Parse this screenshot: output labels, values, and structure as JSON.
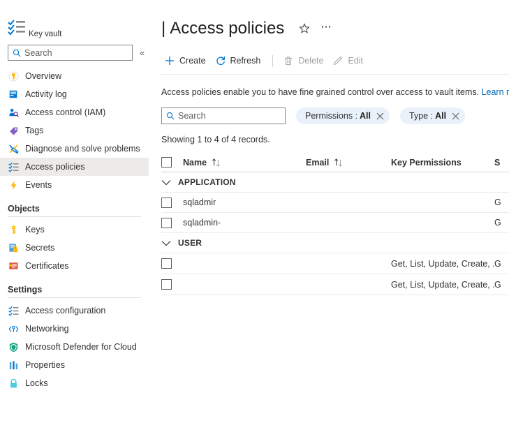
{
  "sidebar": {
    "resource_type": "Key vault",
    "search": {
      "placeholder": "Search"
    },
    "collapse_label": "«",
    "items": [
      {
        "label": "Overview",
        "icon": "key-overview-icon"
      },
      {
        "label": "Activity log",
        "icon": "activity-log-icon"
      },
      {
        "label": "Access control (IAM)",
        "icon": "access-control-icon"
      },
      {
        "label": "Tags",
        "icon": "tag-icon"
      },
      {
        "label": "Diagnose and solve problems",
        "icon": "wrench-icon"
      },
      {
        "label": "Access policies",
        "icon": "checklist-icon",
        "selected": true
      },
      {
        "label": "Events",
        "icon": "lightning-icon"
      }
    ],
    "sections": [
      {
        "title": "Objects",
        "items": [
          {
            "label": "Keys",
            "icon": "key-icon"
          },
          {
            "label": "Secrets",
            "icon": "secret-lock-icon"
          },
          {
            "label": "Certificates",
            "icon": "certificate-icon"
          }
        ]
      },
      {
        "title": "Settings",
        "items": [
          {
            "label": "Access configuration",
            "icon": "checklist-icon"
          },
          {
            "label": "Networking",
            "icon": "networking-icon"
          },
          {
            "label": "Microsoft Defender for Cloud",
            "icon": "shield-icon"
          },
          {
            "label": "Properties",
            "icon": "properties-icon"
          },
          {
            "label": "Locks",
            "icon": "lock-icon"
          }
        ]
      }
    ]
  },
  "header": {
    "separator": "|",
    "title": "Access policies",
    "favorite_icon": "star-icon",
    "more_icon": "ellipsis-icon"
  },
  "toolbar": {
    "create_label": "Create",
    "refresh_label": "Refresh",
    "delete_label": "Delete",
    "edit_label": "Edit"
  },
  "info": {
    "text": "Access policies enable you to have fine grained control over access to vault items. ",
    "link_label": "Learn more"
  },
  "filters": {
    "search_placeholder": "Search",
    "pills": [
      {
        "key": "Permissions :",
        "value": "All"
      },
      {
        "key": "Type :",
        "value": "All"
      }
    ]
  },
  "results": {
    "showing_text": "Showing 1 to 4 of 4 records."
  },
  "table": {
    "columns": [
      {
        "label": "Name",
        "sortable": true
      },
      {
        "label": "Email",
        "sortable": true
      },
      {
        "label": "Key Permissions",
        "sortable": false
      },
      {
        "label": "S",
        "sortable": false
      }
    ],
    "groups": [
      {
        "label": "APPLICATION",
        "rows": [
          {
            "name": "sqladmir",
            "email": "",
            "key_permissions": "",
            "secret_permissions": "G"
          },
          {
            "name": "sqladmin-",
            "email": "",
            "key_permissions": "",
            "secret_permissions": "G"
          }
        ]
      },
      {
        "label": "USER",
        "rows": [
          {
            "name": "",
            "email": "",
            "key_permissions": "Get, List, Update, Create, ...",
            "secret_permissions": "G"
          },
          {
            "name": "",
            "email": "",
            "key_permissions": "Get, List, Update, Create, ...",
            "secret_permissions": "G"
          }
        ]
      }
    ]
  },
  "colors": {
    "accent": "#0067b8",
    "selected_nav": "#edebe9",
    "pill_bg": "#e9f2fa"
  }
}
